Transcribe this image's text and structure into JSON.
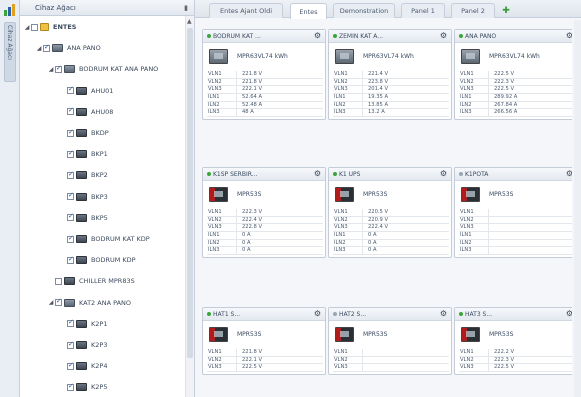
{
  "sidebar_strip": {
    "label": "Cihaz Ağacı"
  },
  "tree": {
    "header": "Cihaz Ağacı",
    "nodes": [
      {
        "label": "ENTES",
        "level": 0,
        "checked": false,
        "icon": "root",
        "bold": true
      },
      {
        "label": "ANA PANO",
        "level": 1,
        "checked": true,
        "icon": "grp"
      },
      {
        "label": "BODRUM KAT ANA PANO",
        "level": 2,
        "checked": true,
        "icon": "grp"
      },
      {
        "label": "AHU01",
        "level": 3,
        "checked": true,
        "icon": "dev"
      },
      {
        "label": "AHU08",
        "level": 3,
        "checked": true,
        "icon": "dev"
      },
      {
        "label": "BKDP",
        "level": 3,
        "checked": true,
        "icon": "dev"
      },
      {
        "label": "BKP1",
        "level": 3,
        "checked": true,
        "icon": "dev"
      },
      {
        "label": "BKP2",
        "level": 3,
        "checked": true,
        "icon": "dev"
      },
      {
        "label": "BKP3",
        "level": 3,
        "checked": true,
        "icon": "dev"
      },
      {
        "label": "BKP5",
        "level": 3,
        "checked": true,
        "icon": "dev"
      },
      {
        "label": "BODRUM KAT KDP",
        "level": 3,
        "checked": true,
        "icon": "dev"
      },
      {
        "label": "BODRUM KDP",
        "level": 3,
        "checked": true,
        "icon": "dev"
      },
      {
        "label": "CHILLER MPR83S",
        "level": 2,
        "checked": false,
        "icon": "dev"
      },
      {
        "label": "KAT2 ANA PANO",
        "level": 2,
        "checked": true,
        "icon": "grp"
      },
      {
        "label": "K2P1",
        "level": 3,
        "checked": true,
        "icon": "dev"
      },
      {
        "label": "K2P3",
        "level": 3,
        "checked": true,
        "icon": "dev"
      },
      {
        "label": "K2P4",
        "level": 3,
        "checked": true,
        "icon": "dev"
      },
      {
        "label": "K2P5",
        "level": 3,
        "checked": true,
        "icon": "dev"
      }
    ]
  },
  "tabs": [
    {
      "label": "Entes Ajant Oldi",
      "active": false
    },
    {
      "label": "Entes",
      "active": true
    },
    {
      "label": "Demonstration",
      "active": false
    },
    {
      "label": "Panel 1",
      "active": false
    },
    {
      "label": "Panel 2",
      "active": false
    }
  ],
  "colors": {
    "online": "#3aa63a",
    "offline": "#9aa6b4",
    "accent": "#2b5fa8"
  },
  "cards": [
    {
      "title": "BODRUM KAT ...",
      "status": "online",
      "meter": "gray",
      "model": "MPR63VL74 kWh",
      "rows": [
        [
          "VLN1",
          "221.8 V"
        ],
        [
          "VLN2",
          "221.8 V"
        ],
        [
          "VLN3",
          "222.1 V"
        ],
        [
          "ILN1",
          "52.64 A"
        ],
        [
          "ILN2",
          "52.48 A"
        ],
        [
          "ILN3",
          "48 A"
        ]
      ]
    },
    {
      "title": "ZEMIN KAT A...",
      "status": "online",
      "meter": "gray",
      "model": "MPR63VL74 kWh",
      "rows": [
        [
          "VLN1",
          "221.4 V"
        ],
        [
          "VLN2",
          "223.8 V"
        ],
        [
          "VLN3",
          "201.4 V"
        ],
        [
          "ILN1",
          "19.35 A"
        ],
        [
          "ILN2",
          "13.85 A"
        ],
        [
          "ILN3",
          "13.2 A"
        ]
      ]
    },
    {
      "title": "ANA PANO",
      "status": "online",
      "meter": "gray",
      "model": "MPR63VL74 kWh",
      "rows": [
        [
          "VLN1",
          "222.5 V"
        ],
        [
          "VLN2",
          "222.3 V"
        ],
        [
          "VLN3",
          "222.5 V"
        ],
        [
          "ILN1",
          "289.92 A"
        ],
        [
          "ILN2",
          "267.84 A"
        ],
        [
          "ILN3",
          "266.56 A"
        ]
      ]
    },
    {
      "title": "K1SP SERBIR...",
      "status": "online",
      "meter": "red",
      "model": "MPR53S",
      "rows": [
        [
          "VLN1",
          "222.3 V"
        ],
        [
          "VLN2",
          "222.4 V"
        ],
        [
          "VLN3",
          "222.8 V"
        ],
        [
          "ILN1",
          "0 A"
        ],
        [
          "ILN2",
          "0 A"
        ],
        [
          "ILN3",
          "0 A"
        ]
      ]
    },
    {
      "title": "K1 UPS",
      "status": "online",
      "meter": "red",
      "model": "MPR53S",
      "rows": [
        [
          "VLN1",
          "220.5 V"
        ],
        [
          "VLN2",
          "220.9 V"
        ],
        [
          "VLN3",
          "222.4 V"
        ],
        [
          "ILN1",
          "0 A"
        ],
        [
          "ILN2",
          "0 A"
        ],
        [
          "ILN3",
          "0 A"
        ]
      ]
    },
    {
      "title": "K1POTA",
      "status": "offline",
      "meter": "red",
      "model": "MPR53S",
      "rows": [
        [
          "VLN1",
          ""
        ],
        [
          "VLN2",
          ""
        ],
        [
          "VLN3",
          ""
        ],
        [
          "ILN1",
          ""
        ],
        [
          "ILN2",
          ""
        ],
        [
          "ILN3",
          ""
        ]
      ]
    },
    {
      "title": "HAT1 S...",
      "status": "online",
      "meter": "red",
      "model": "MPR53S",
      "rows": [
        [
          "VLN1",
          "221.8 V"
        ],
        [
          "VLN2",
          "222.1 V"
        ],
        [
          "VLN3",
          "222.5 V"
        ]
      ]
    },
    {
      "title": "HAT2 S...",
      "status": "offline",
      "meter": "red",
      "model": "MPR53S",
      "rows": [
        [
          "VLN1",
          ""
        ],
        [
          "VLN2",
          ""
        ],
        [
          "VLN3",
          ""
        ]
      ]
    },
    {
      "title": "HAT3 S...",
      "status": "online",
      "meter": "red",
      "model": "MPR53S",
      "rows": [
        [
          "VLN1",
          "222.2 V"
        ],
        [
          "VLN2",
          "222.3 V"
        ],
        [
          "VLN3",
          "222.5 V"
        ]
      ]
    }
  ]
}
